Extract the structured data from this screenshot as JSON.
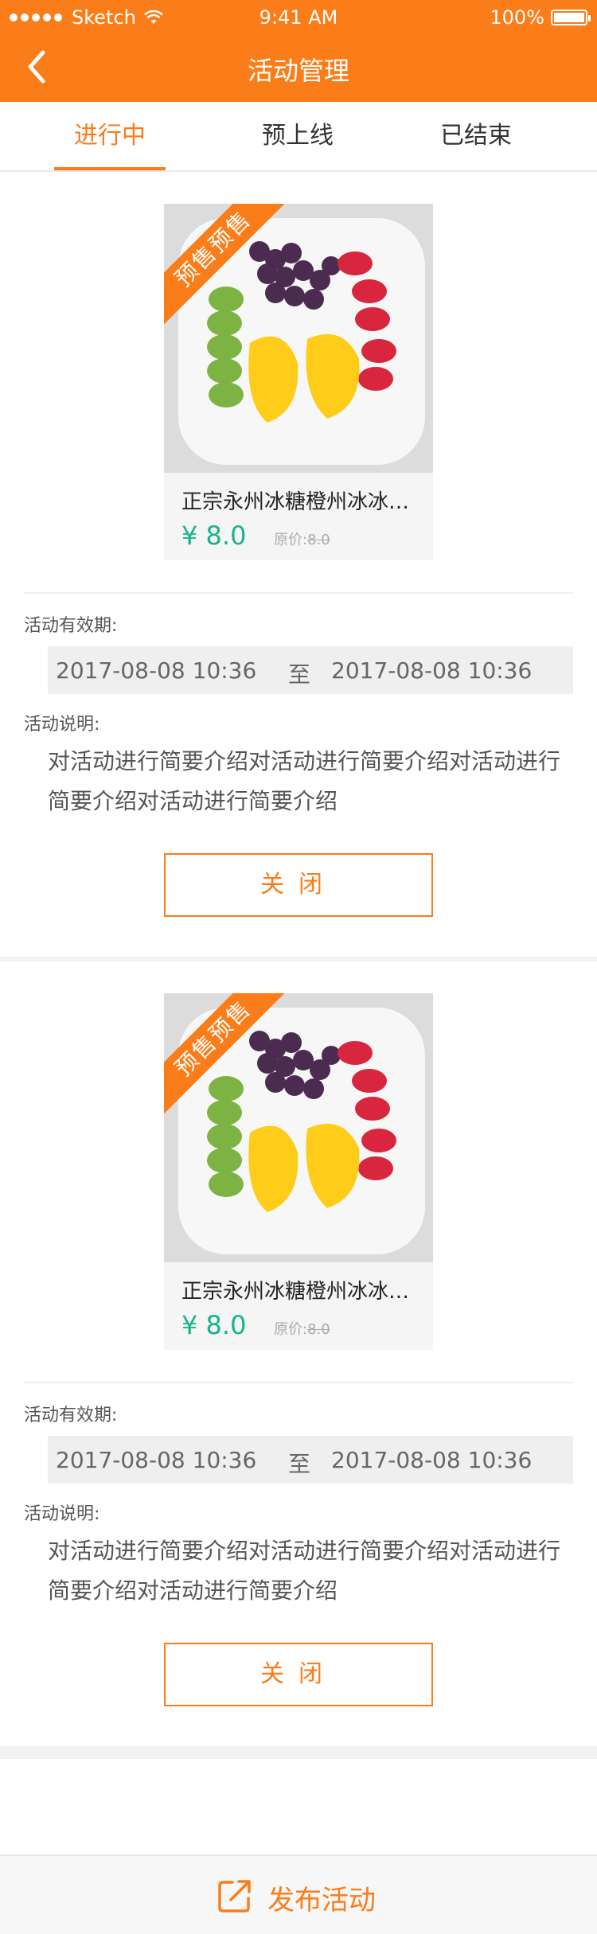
{
  "status": {
    "carrier": "Sketch",
    "time": "9:41 AM",
    "battery": "100%"
  },
  "nav": {
    "title": "活动管理"
  },
  "tabs": [
    {
      "label": "进行中",
      "active": true
    },
    {
      "label": "预上线",
      "active": false
    },
    {
      "label": "已结束",
      "active": false
    }
  ],
  "activities": [
    {
      "badge": "预售预售",
      "product_name": "正宗永州冰糖橙州冰冰…",
      "price": "¥ 8.0",
      "orig_label": "原价:",
      "orig_price": "8.0",
      "validity_label": "活动有效期:",
      "start": "2017-08-08  10:36",
      "to": "至",
      "end": "2017-08-08  10:36",
      "desc_label": "活动说明:",
      "desc": "对活动进行简要介绍对活动进行简要介绍对活动进行简要介绍对活动进行简要介绍",
      "close_label": "关闭"
    },
    {
      "badge": "预售预售",
      "product_name": "正宗永州冰糖橙州冰冰…",
      "price": "¥ 8.0",
      "orig_label": "原价:",
      "orig_price": "8.0",
      "validity_label": "活动有效期:",
      "start": "2017-08-08  10:36",
      "to": "至",
      "end": "2017-08-08  10:36",
      "desc_label": "活动说明:",
      "desc": "对活动进行简要介绍对活动进行简要介绍对活动进行简要介绍对活动进行简要介绍",
      "close_label": "关闭"
    }
  ],
  "bottom": {
    "label": "发布活动",
    "icon": "share-icon"
  },
  "colors": {
    "brand": "#fa7d19",
    "price": "#16b48c"
  }
}
